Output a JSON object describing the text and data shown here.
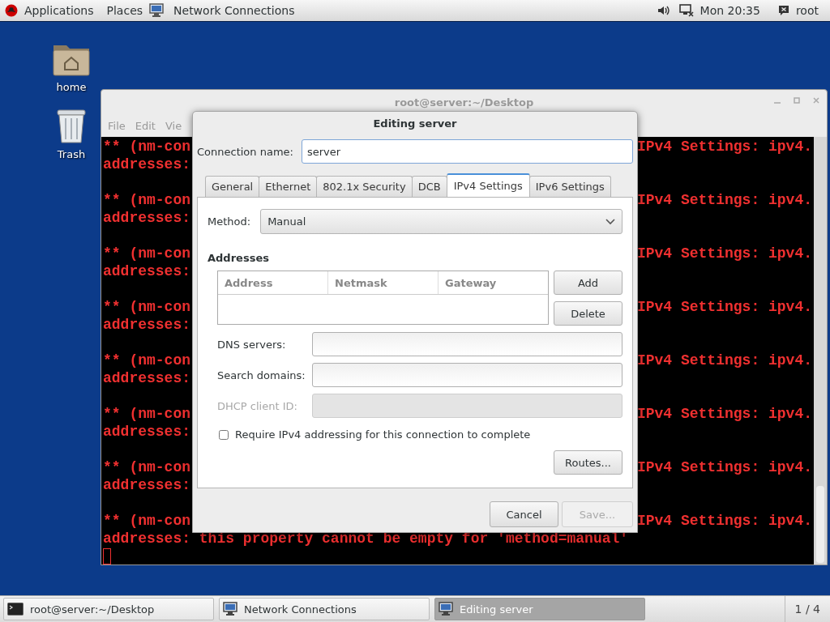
{
  "top_bar": {
    "applications": "Applications",
    "places": "Places",
    "app_title": "Network Connections",
    "clock": "Mon 20:35",
    "user": "root"
  },
  "desktop_icons": [
    {
      "label": "home",
      "kind": "folder"
    },
    {
      "label": "Trash",
      "kind": "trash"
    }
  ],
  "terminal": {
    "title": "root@server:~/Desktop",
    "menu": [
      "File",
      "Edit",
      "Vie"
    ],
    "messages": [
      {
        "head": "** (nm-con",
        "tail": "IPv4 Settings: ipv4.",
        "detail": "addresses:"
      },
      {
        "head": "** (nm-con",
        "tail": "IPv4 Settings: ipv4.",
        "detail": "addresses:"
      },
      {
        "head": "** (nm-con",
        "tail": "IPv4 Settings: ipv4.",
        "detail": "addresses:"
      },
      {
        "head": "** (nm-con",
        "tail": "IPv4 Settings: ipv4.",
        "detail": "addresses:"
      },
      {
        "head": "** (nm-con",
        "tail": "IPv4 Settings: ipv4.",
        "detail": "addresses:"
      },
      {
        "head": "** (nm-con",
        "tail": "IPv4 Settings: ipv4.",
        "detail": "addresses:"
      },
      {
        "head": "** (nm-con",
        "tail": "IPv4 Settings: ipv4.",
        "detail": "addresses:"
      },
      {
        "head": "** (nm-con",
        "tail": "IPv4 Settings: ipv4.",
        "detail": "addresses: this property cannot be empty for 'method=manual'"
      }
    ]
  },
  "dialog": {
    "title": "Editing server",
    "connection_name": {
      "label": "Connection name:",
      "value": "server"
    },
    "tabs": [
      {
        "label": "General",
        "selected": false
      },
      {
        "label": "Ethernet",
        "selected": false
      },
      {
        "label": "802.1x Security",
        "selected": false
      },
      {
        "label": "DCB",
        "selected": false
      },
      {
        "label": "IPv4 Settings",
        "selected": true
      },
      {
        "label": "IPv6 Settings",
        "selected": false
      }
    ],
    "method": {
      "label": "Method:",
      "value": "Manual"
    },
    "addresses": {
      "heading": "Addresses",
      "columns": [
        "Address",
        "Netmask",
        "Gateway"
      ],
      "buttons": [
        "Add",
        "Delete"
      ]
    },
    "fields": [
      {
        "label": "DNS servers:",
        "disabled": false
      },
      {
        "label": "Search domains:",
        "disabled": false
      },
      {
        "label": "DHCP client ID:",
        "disabled": true
      }
    ],
    "require": {
      "label": "Require IPv4 addressing for this connection to complete",
      "checked": false
    },
    "routes_button": "Routes...",
    "buttons": [
      {
        "label": "Cancel",
        "disabled": false
      },
      {
        "label": "Save...",
        "disabled": true
      }
    ]
  },
  "taskbar": {
    "items": [
      {
        "label": "root@server:~/Desktop",
        "kind": "terminal",
        "selected": false
      },
      {
        "label": "Network Connections",
        "kind": "network",
        "selected": false
      },
      {
        "label": "Editing server",
        "kind": "network",
        "selected": true
      }
    ],
    "workspace": "1 / 4"
  }
}
